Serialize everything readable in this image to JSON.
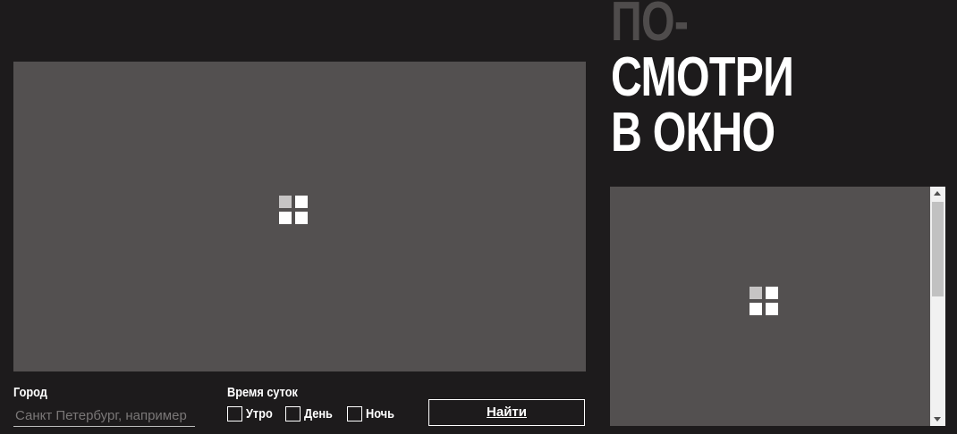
{
  "heading": {
    "line1": "ПО-",
    "line2": "СМОТРИ",
    "line3": "В ОКНО"
  },
  "main_view": {
    "icon": "windows-logo-icon"
  },
  "side_panel": {
    "icon": "windows-logo-icon"
  },
  "form": {
    "city_label": "Город",
    "city_placeholder": "Санкт Петербург, например",
    "city_value": "",
    "time_label": "Время суток",
    "options": [
      {
        "label": "Утро",
        "checked": false
      },
      {
        "label": "День",
        "checked": false
      },
      {
        "label": "Ночь",
        "checked": false
      }
    ],
    "find_label": "Найти"
  },
  "colors": {
    "background": "#1d1b1c",
    "panel": "#535050",
    "heading_muted": "#4f4c4c",
    "text": "#ffffff"
  }
}
